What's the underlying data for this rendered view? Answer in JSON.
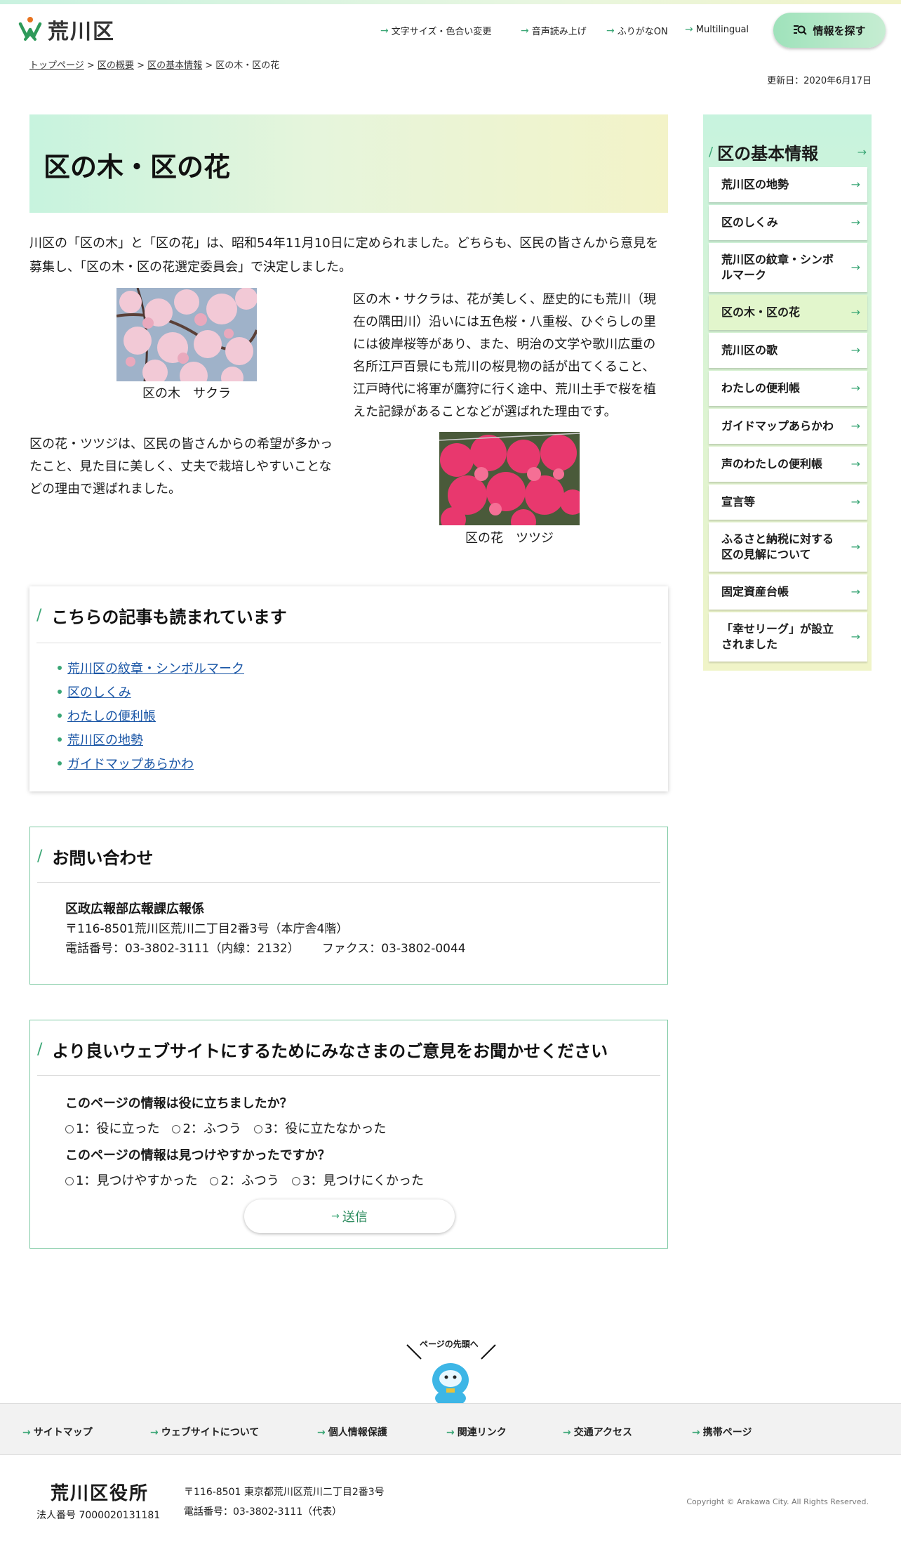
{
  "header": {
    "logo_text": "荒川区",
    "nav": [
      "文字サイズ・色合い変更",
      "音声読み上げ",
      "ふりがなON",
      "Multilingual"
    ],
    "search_label": "情報を探す"
  },
  "breadcrumb": {
    "items": [
      "トップページ",
      "区の概要",
      "区の基本情報"
    ],
    "current": "区の木・区の花",
    "sep": " > "
  },
  "updated": "更新日：2020年6月17日",
  "page_title": "区の木・区の花",
  "intro": "川区の「区の木」と「区の花」は、昭和54年11月10日に定められました。どちらも、区民の皆さんから意見を募集し、「区の木・区の花選定委員会」で決定しました。",
  "sakura": {
    "caption": "区の木　サクラ",
    "text": "区の木・サクラは、花が美しく、歴史的にも荒川（現在の隅田川）沿いには五色桜・八重桜、ひぐらしの里には彼岸桜等があり、また、明治の文学や歌川広重の名所江戸百景にも荒川の桜見物の話が出てくること、江戸時代に将軍が鷹狩に行く途中、荒川土手で桜を植えた記録があることなどが選ばれた理由です。"
  },
  "tsutsuji": {
    "caption": "区の花　ツツジ",
    "text": "区の花・ツツジは、区民の皆さんからの希望が多かったこと、見た目に美しく、丈夫で栽培しやすいことなどの理由で選ばれました。"
  },
  "related": {
    "title": "こちらの記事も読まれています",
    "links": [
      "荒川区の紋章・シンボルマーク",
      "区のしくみ",
      "わたしの便利帳",
      "荒川区の地勢",
      "ガイドマップあらかわ"
    ]
  },
  "contact": {
    "title": "お問い合わせ",
    "dept": "区政広報部広報課広報係",
    "address": "〒116-8501荒川区荒川二丁目2番3号（本庁舎4階）",
    "tel": "電話番号：03-3802-3111（内線：2132）",
    "fax": "ファクス：03-3802-0044"
  },
  "feedback": {
    "title": "より良いウェブサイトにするためにみなさまのご意見をお聞かせください",
    "q1": "このページの情報は役に立ちましたか？",
    "q1_options": [
      "1：役に立った",
      "2：ふつう",
      "3：役に立たなかった"
    ],
    "q2": "このページの情報は見つけやすかったですか？",
    "q2_options": [
      "1：見つけやすかった",
      "2：ふつう",
      "3：見つけにくかった"
    ],
    "submit": "送信"
  },
  "sidebar": {
    "title": "区の基本情報",
    "items": [
      "荒川区の地勢",
      "区のしくみ",
      "荒川区の紋章・シンボルマーク",
      "区の木・区の花",
      "荒川区の歌",
      "わたしの便利帳",
      "ガイドマップあらかわ",
      "声のわたしの便利帳",
      "宣言等",
      "ふるさと納税に対する区の見解について",
      "固定資産台帳",
      "「幸せリーグ」が設立されました"
    ],
    "active_index": 3
  },
  "pagetop": "ページの先頭へ",
  "footer_nav": [
    "サイトマップ",
    "ウェブサイトについて",
    "個人情報保護",
    "関連リンク",
    "交通アクセス",
    "携帯ページ"
  ],
  "footer": {
    "name": "荒川区役所",
    "corp_no": "法人番号 7000020131181",
    "address": "〒116-8501 東京都荒川区荒川二丁目2番3号",
    "tel": "電話番号：03-3802-3111（代表）",
    "copyright": "Copyright © Arakawa City. All Rights Reserved."
  },
  "colors": {
    "accent": "#3aa675",
    "link": "#1a56a6",
    "title_gradient": [
      "#c7f3de",
      "#f3f3c8"
    ]
  }
}
